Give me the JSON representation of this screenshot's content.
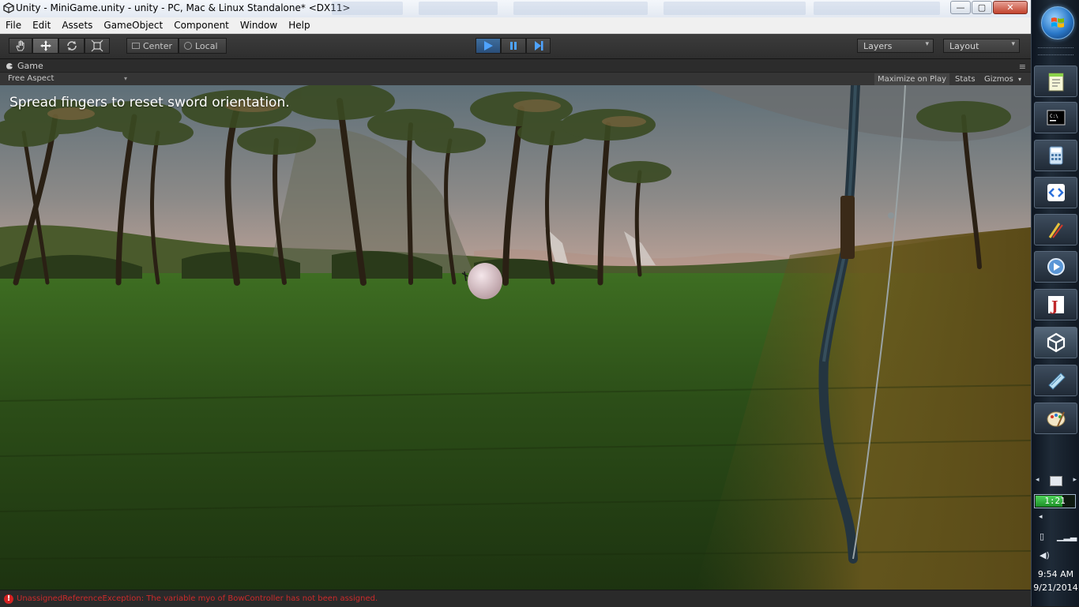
{
  "window": {
    "title": "Unity - MiniGame.unity - unity - PC, Mac & Linux Standalone* <DX11>",
    "controls": {
      "minimize": "—",
      "maximize": "▢",
      "close": "✕"
    }
  },
  "menu": [
    "File",
    "Edit",
    "Assets",
    "GameObject",
    "Component",
    "Window",
    "Help"
  ],
  "toolbar": {
    "tools": [
      "hand-tool",
      "move-tool",
      "rotate-tool",
      "scale-tool"
    ],
    "pivot_label": "Center",
    "space_label": "Local",
    "layers_label": "Layers",
    "layout_label": "Layout"
  },
  "game_view": {
    "tab_label": "Game",
    "aspect_label": "Free Aspect",
    "maximize_label": "Maximize on Play",
    "stats_label": "Stats",
    "gizmos_label": "Gizmos",
    "hint_text": "Spread fingers to reset sword orientation."
  },
  "console": {
    "error_icon": "!",
    "message": "UnassignedReferenceException: The variable myo of BowController has not been assigned."
  },
  "taskbar": {
    "battery_time": "1:21",
    "battery_fraction": 0.7,
    "clock_time": "9:54 AM",
    "clock_date": "9/21/2014",
    "apps": [
      "notepad-plus-icon",
      "command-prompt-icon",
      "calculator-icon",
      "code-editor-icon",
      "pen-tool-icon",
      "media-app-icon",
      "java-icon",
      "unity-icon",
      "notepad-icon",
      "paint-icon"
    ]
  },
  "colors": {
    "unity_dark": "#2c2c2c",
    "play_blue": "#3f6e9e",
    "error_red": "#cc2a2a",
    "battery_green": "#1c8f26"
  }
}
